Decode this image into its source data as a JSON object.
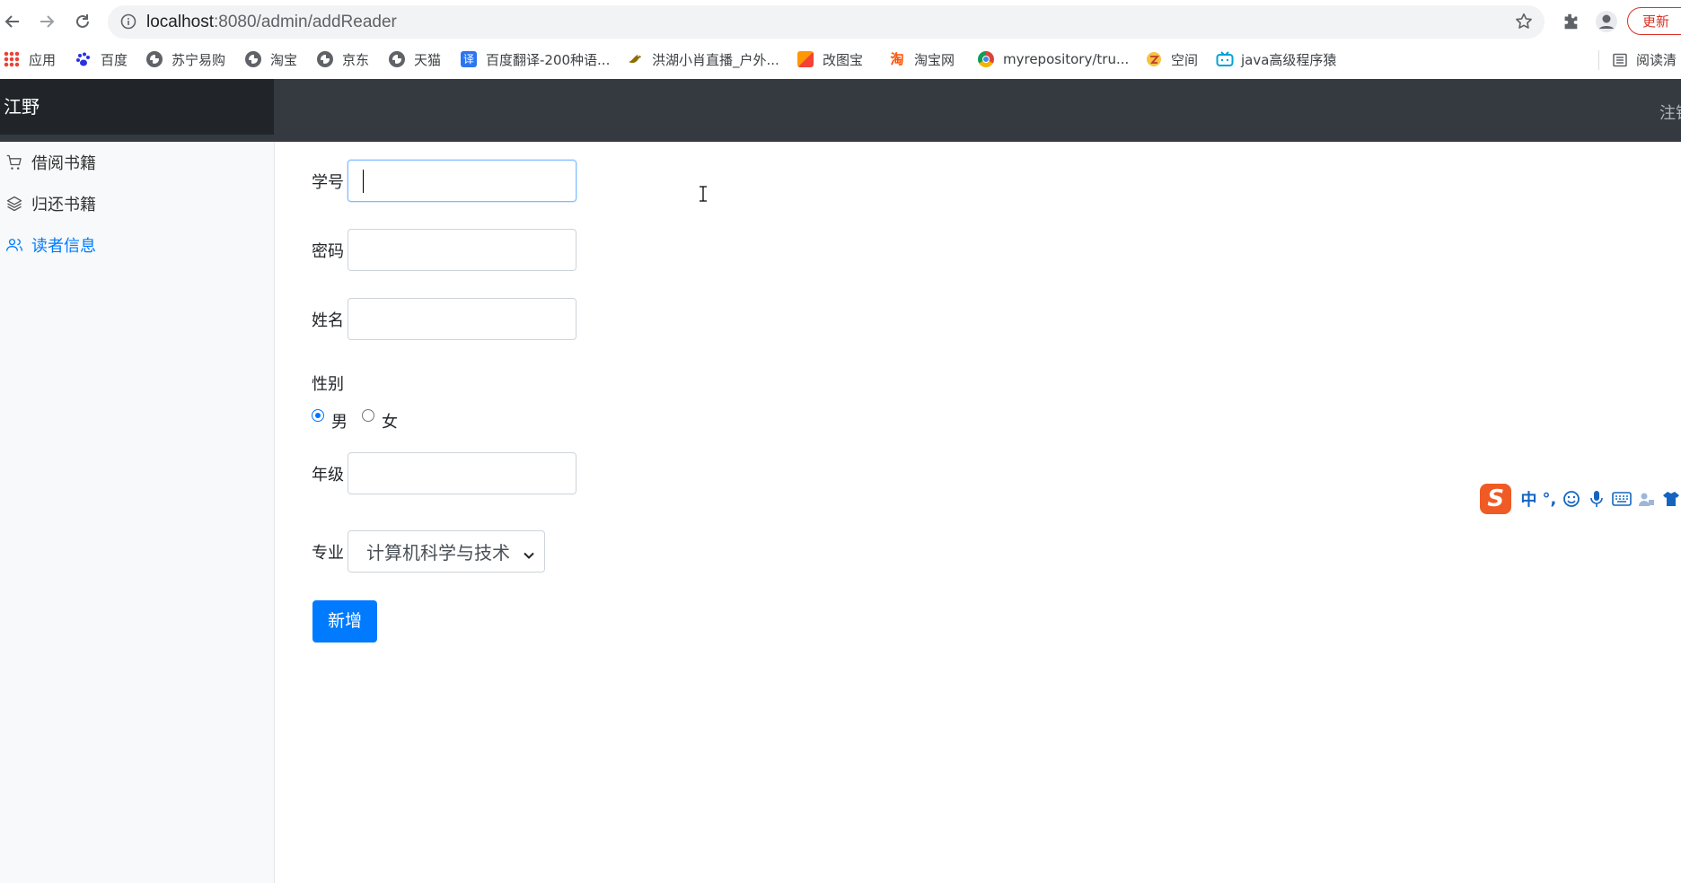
{
  "browser": {
    "url_host": "localhost",
    "url_rest": ":8080/admin/addReader",
    "update_label": "更新",
    "bookmarks": [
      {
        "label": "应用",
        "icon": "apps-grid-icon"
      },
      {
        "label": "百度",
        "icon": "baidu-paw-icon"
      },
      {
        "label": "苏宁易购",
        "icon": "globe-icon"
      },
      {
        "label": "淘宝",
        "icon": "globe-icon"
      },
      {
        "label": "京东",
        "icon": "globe-icon"
      },
      {
        "label": "天猫",
        "icon": "globe-icon"
      },
      {
        "label": "百度翻译-200种语...",
        "icon": "translate-icon"
      },
      {
        "label": "洪湖小肖直播_户外...",
        "icon": "bird-icon"
      },
      {
        "label": "改图宝",
        "icon": "image-edit-icon"
      },
      {
        "label": "淘宝网",
        "icon": "taobao-icon"
      },
      {
        "label": "myrepository/tru...",
        "icon": "chrome-logo-icon"
      },
      {
        "label": "空间",
        "icon": "qzone-icon"
      },
      {
        "label": "java高级程序猿",
        "icon": "bilibili-icon"
      }
    ],
    "reading_list_label": "阅读清"
  },
  "app": {
    "brand": "江野",
    "header_right": "注销",
    "sidebar": [
      {
        "label": "借阅书籍",
        "icon": "cart-icon",
        "active": false
      },
      {
        "label": "归还书籍",
        "icon": "layers-icon",
        "active": false
      },
      {
        "label": "读者信息",
        "icon": "users-icon",
        "active": true
      }
    ],
    "form": {
      "student_id_label": "学号",
      "student_id_value": "",
      "password_label": "密码",
      "name_label": "姓名",
      "gender_label": "性别",
      "gender_options": [
        "男",
        "女"
      ],
      "gender_selected": "男",
      "grade_label": "年级",
      "major_label": "专业",
      "major_selected": "计算机科学与技术",
      "submit_label": "新增"
    }
  },
  "ime": {
    "logo": "S",
    "mode": "中",
    "punct": "°,"
  },
  "colors": {
    "primary": "#007bff",
    "header_bg": "#343a40",
    "brand_bg": "#212529",
    "sidebar_bg": "#f8f9fa",
    "update_red": "#d93025",
    "ime_orange": "#f05a24"
  }
}
